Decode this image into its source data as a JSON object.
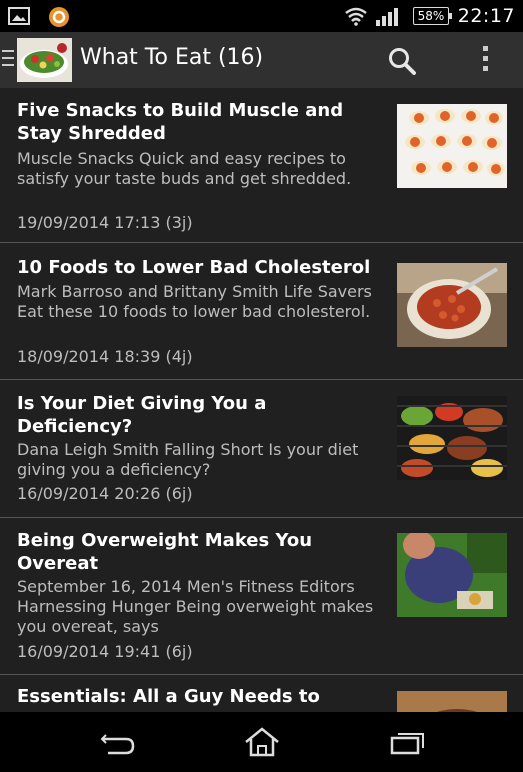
{
  "status_bar": {
    "time": "22:17",
    "battery": "58%",
    "icons": [
      "image-notification-icon",
      "orange-app-icon",
      "wifi-icon",
      "signal-icon",
      "battery-icon"
    ]
  },
  "action_bar": {
    "title": "What To Eat (16)",
    "icons": [
      "drawer-icon",
      "app-logo",
      "search-icon",
      "overflow-menu-icon"
    ]
  },
  "articles": [
    {
      "title": "Five Snacks to Build Muscle and Stay Shredded",
      "description": "Muscle Snacks Quick and easy recipes to satisfy your taste buds and get shredded.",
      "date": "19/09/2014 17:13 (3j)",
      "thumbnail": "deviled-eggs-image"
    },
    {
      "title": "10 Foods to Lower Bad Cholesterol",
      "description": "Mark Barroso and Brittany Smith Life Savers Eat these 10 foods to lower bad cholesterol.",
      "date": "18/09/2014 18:39 (4j)",
      "thumbnail": "beans-bowl-image"
    },
    {
      "title": "Is Your Diet Giving You a Deficiency?",
      "description": "Dana Leigh Smith Falling Short Is your diet giving you a deficiency?",
      "date": "16/09/2014 20:26 (6j)",
      "thumbnail": "grilled-food-image"
    },
    {
      "title": "Being Overweight Makes You Overeat",
      "description": "September 16, 2014 Men's Fitness Editors Harnessing Hunger Being overweight makes you overeat, says",
      "date": "16/09/2014 19:41 (6j)",
      "thumbnail": "man-eating-image"
    },
    {
      "title": "Essentials: All a Guy Needs to",
      "description": "",
      "date": "",
      "thumbnail": "food-image"
    }
  ],
  "nav_bar": {
    "icons": [
      "back-icon",
      "home-icon",
      "recent-apps-icon"
    ]
  },
  "colors": {
    "background": "#202020",
    "action_bar": "#303030",
    "divider": "#555555",
    "secondary_text": "#bdbdbd"
  }
}
